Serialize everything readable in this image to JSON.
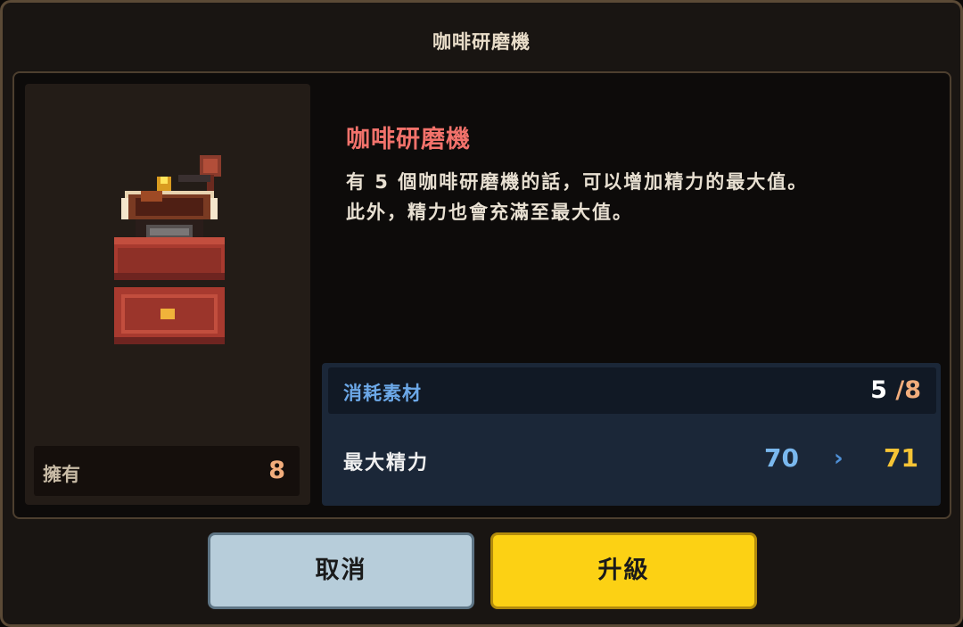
{
  "dialog": {
    "title": "咖啡研磨機"
  },
  "item": {
    "name": "咖啡研磨機",
    "description_lines": [
      "有 5 個咖啡研磨機的話，可以增加精力的最大值。",
      "此外，精力也會充滿至最大值。"
    ],
    "icon": "coffee-grinder-icon",
    "owned_label": "擁有",
    "owned_count": "8"
  },
  "cost": {
    "label": "消耗素材",
    "have": "5",
    "need": "/8"
  },
  "stat": {
    "label": "最大精力",
    "from": "70",
    "arrow": "›",
    "to": "71"
  },
  "buttons": {
    "cancel": "取消",
    "upgrade": "升級"
  },
  "colors": {
    "item_name": "#f2726b",
    "cost_label": "#6ca8e8",
    "stat_to": "#f6c435",
    "upgrade_button": "#fcd114",
    "cancel_button": "#b7cdda"
  }
}
